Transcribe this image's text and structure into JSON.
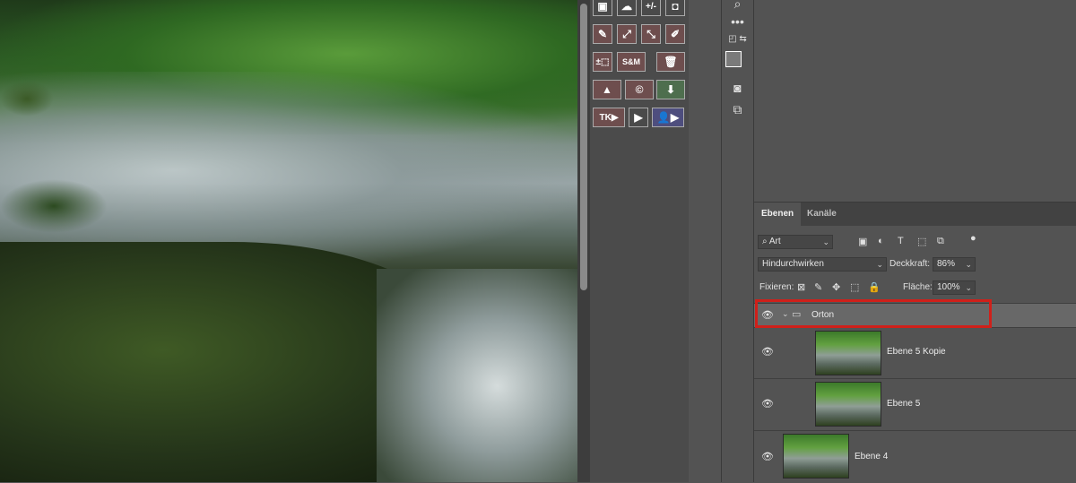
{
  "actions": {
    "row1": [
      "+/-"
    ],
    "row3": [
      "±",
      "S&M"
    ],
    "row5": [
      "TK▶",
      "▶"
    ]
  },
  "layers_panel": {
    "tabs": [
      "Ebenen",
      "Kanäle"
    ],
    "filter": "Art",
    "blend_mode": "Hindurchwirken",
    "opacity_label": "Deckkraft:",
    "opacity_value": "86%",
    "lock_label": "Fixieren:",
    "fill_label": "Fläche:",
    "fill_value": "100%",
    "layers": [
      {
        "name": "Orton",
        "type": "group",
        "expanded": true,
        "highlighted": true
      },
      {
        "name": "Ebene 5 Kopie",
        "type": "layer"
      },
      {
        "name": "Ebene 5",
        "type": "layer"
      },
      {
        "name": "Ebene 4",
        "type": "layer"
      }
    ]
  },
  "colors": {
    "highlight": "#d0201a",
    "panel_bg": "#535353"
  }
}
